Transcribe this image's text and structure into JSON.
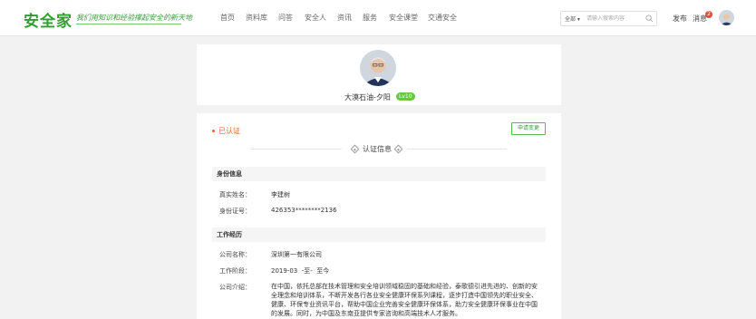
{
  "header": {
    "logo": "安全家",
    "slogan": "我们用知识和经验撑起安全的新天地",
    "nav": [
      "首页",
      "资料库",
      "问答",
      "安全人",
      "资讯",
      "服务",
      "安全课堂",
      "交通安全"
    ],
    "search": {
      "scope": "全部",
      "placeholder": "请输入搜索内容"
    },
    "publish_label": "发布",
    "message_label": "消息",
    "message_count": "2"
  },
  "profile": {
    "username": "大漠石油-夕阳",
    "level": "Lv10"
  },
  "certification": {
    "status": "已认证",
    "apply_change_label": "申请变更",
    "title": "认证信息"
  },
  "identity": {
    "section_title": "身份信息",
    "name_label": "真实姓名：",
    "name_value": "李建树",
    "id_label": "身份证号：",
    "id_value": "426353********2136"
  },
  "work": {
    "section_title": "工作经历",
    "company_label": "公司名称：",
    "company_value": "深圳第一有限公司",
    "period_label": "工作阶段：",
    "period_value": "2019-03  -至-  至今",
    "intro_label": "公司介绍：",
    "intro_value": "在中国，依托总部在技术管理和安全培训领域稳固的基础和经验，泰歌德引进先进的、创新的安全理念和培训体系，不断开发各行各业安全健康环保系列课程，逐步打造中国领先的职业安全、健康、环保专业资讯平台，帮助中国企业完善安全健康环保体系，助力安全健康环保事业在中国的发展。同时，为中国及东南亚提供专家咨询和高端技术人才服务。"
  },
  "colors": {
    "brand_green": "#2f9e2f",
    "accent_orange": "#e8633a",
    "badge_red": "#e74c3c"
  }
}
